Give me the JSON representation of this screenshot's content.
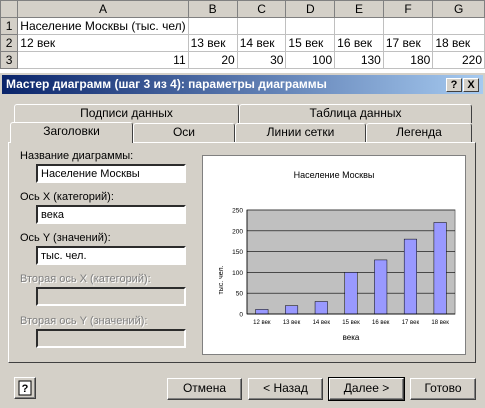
{
  "sheet": {
    "columns": [
      "A",
      "B",
      "C",
      "D",
      "E",
      "F",
      "G"
    ],
    "rows": [
      {
        "num": "1",
        "cells": [
          "Население Москвы (тыс. чел)",
          "",
          "",
          "",
          "",
          "",
          ""
        ]
      },
      {
        "num": "2",
        "cells": [
          "12 век",
          "13 век",
          "14 век",
          "15 век",
          "16 век",
          "17 век",
          "18 век"
        ]
      },
      {
        "num": "3",
        "cells": [
          "11",
          "20",
          "30",
          "100",
          "130",
          "180",
          "220"
        ]
      }
    ]
  },
  "dialog": {
    "title": "Мастер диаграмм (шаг 3 из 4): параметры диаграммы",
    "help_btn": "?",
    "close_btn": "X",
    "tabs_back": [
      "Подписи данных",
      "Таблица данных"
    ],
    "tabs_front": [
      "Заголовки",
      "Оси",
      "Линии сетки",
      "Легенда"
    ],
    "active_tab": "Заголовки",
    "fields": {
      "chart_title_label": "Название диаграммы:",
      "chart_title_value": "Население Москвы",
      "x_axis_label": "Ось X (категорий):",
      "x_axis_value": "века",
      "y_axis_label": "Ось Y (значений):",
      "y_axis_value": "тыс. чел.",
      "x2_axis_label": "Вторая ось X (категорий):",
      "x2_axis_value": "",
      "y2_axis_label": "Вторая ось Y (значений):",
      "y2_axis_value": ""
    },
    "buttons": {
      "cancel": "Отмена",
      "back": "< Назад",
      "next": "Далее >",
      "finish": "Готово"
    }
  },
  "chart_data": {
    "type": "bar",
    "title": "Население Москвы",
    "xlabel": "века",
    "ylabel": "тыс. чел.",
    "categories": [
      "12 век",
      "13 век",
      "14 век",
      "15 век",
      "16 век",
      "17 век",
      "18 век"
    ],
    "values": [
      11,
      20,
      30,
      100,
      130,
      180,
      220
    ],
    "ylim": [
      0,
      250
    ],
    "yticks": [
      0,
      50,
      100,
      150,
      200,
      250
    ],
    "grid": true,
    "bar_color": "#9999ff",
    "plot_bg": "#c0c0c0"
  }
}
